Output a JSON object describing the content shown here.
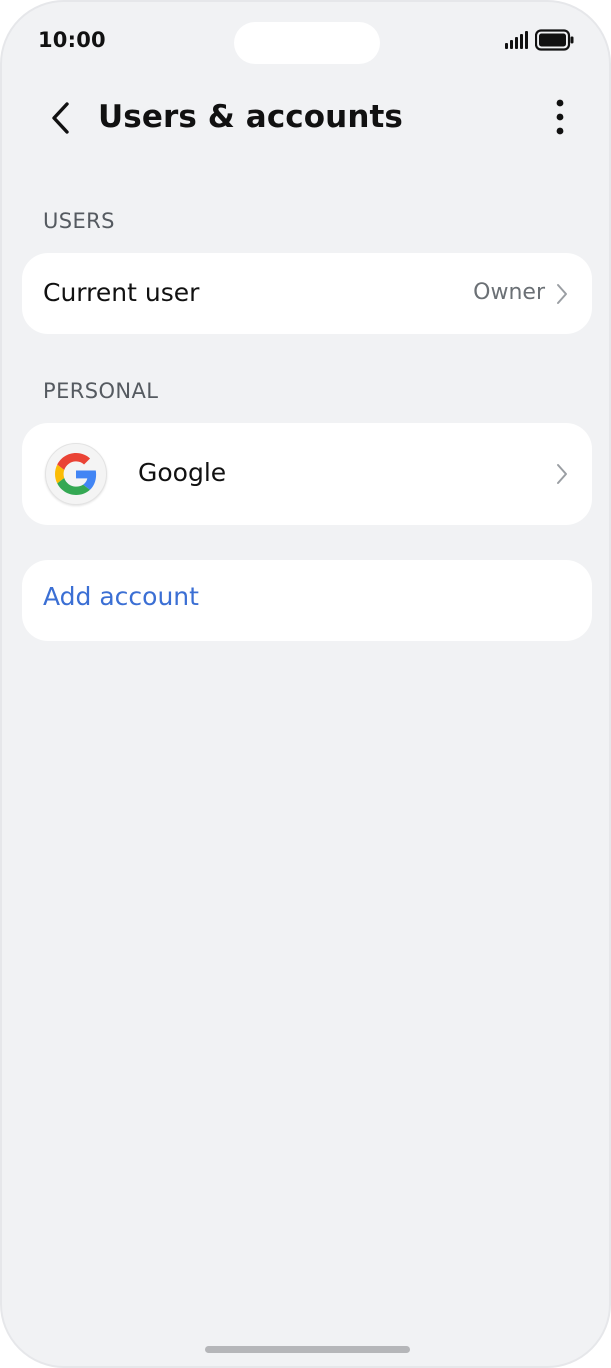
{
  "status_bar": {
    "time": "10:00",
    "icons": [
      "signal-icon",
      "battery-icon"
    ]
  },
  "header": {
    "back_icon": "chevron-left-icon",
    "title": "Users & accounts",
    "more_icon": "more-vertical-icon"
  },
  "users_section": {
    "label": "USERS",
    "current_user": {
      "title": "Current user",
      "value": "Owner",
      "icon": "chevron-right-icon"
    }
  },
  "personal_section": {
    "label": "PERSONAL",
    "accounts": [
      {
        "title": "Google",
        "icon": "google-logo-icon",
        "chevron": "chevron-right-icon"
      }
    ]
  },
  "add_account": {
    "label": "Add account"
  },
  "colors": {
    "background": "#f1f2f4",
    "card": "#ffffff",
    "accent": "#3b6fd4",
    "secondary_text": "#6b7075",
    "google_blue": "#4285F4",
    "google_red": "#EA4335",
    "google_yellow": "#FBBC05",
    "google_green": "#34A853"
  }
}
